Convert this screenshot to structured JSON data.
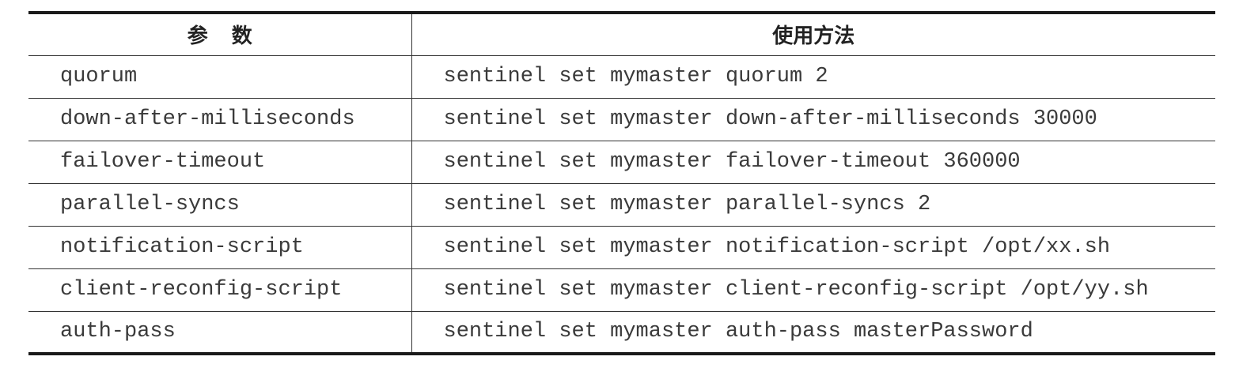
{
  "table": {
    "headers": [
      "参数",
      "使用方法"
    ],
    "rows": [
      [
        "quorum",
        "sentinel set mymaster quorum 2"
      ],
      [
        "down-after-milliseconds",
        "sentinel set mymaster down-after-milliseconds 30000"
      ],
      [
        "failover-timeout",
        "sentinel set mymaster failover-timeout 360000"
      ],
      [
        "parallel-syncs",
        "sentinel set mymaster parallel-syncs 2"
      ],
      [
        "notification-script",
        "sentinel set mymaster notification-script /opt/xx.sh"
      ],
      [
        "client-reconfig-script",
        "sentinel set mymaster client-reconfig-script /opt/yy.sh"
      ],
      [
        "auth-pass",
        "sentinel set mymaster auth-pass masterPassword"
      ]
    ]
  }
}
